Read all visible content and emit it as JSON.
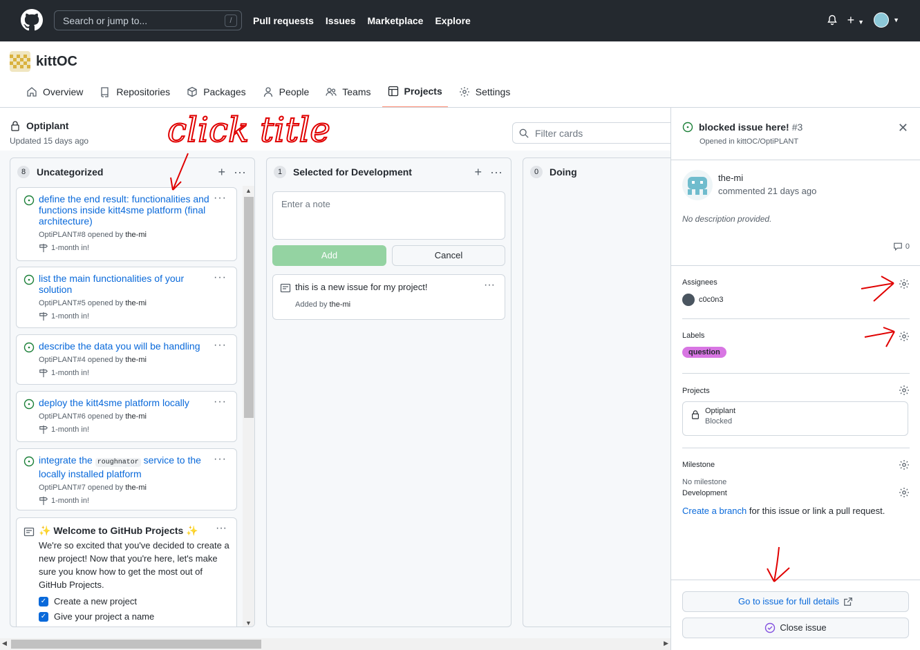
{
  "header": {
    "search_placeholder": "Search or jump to...",
    "search_shortcut": "/",
    "nav": [
      "Pull requests",
      "Issues",
      "Marketplace",
      "Explore"
    ]
  },
  "org": {
    "name": "kittOC",
    "tabs": [
      {
        "label": "Overview",
        "icon": "home-icon"
      },
      {
        "label": "Repositories",
        "icon": "repo-icon"
      },
      {
        "label": "Packages",
        "icon": "package-icon"
      },
      {
        "label": "People",
        "icon": "person-icon"
      },
      {
        "label": "Teams",
        "icon": "people-icon"
      },
      {
        "label": "Projects",
        "icon": "table-icon",
        "active": true
      },
      {
        "label": "Settings",
        "icon": "gear-icon"
      }
    ]
  },
  "project": {
    "title": "Optiplant",
    "updated": "Updated 15 days ago",
    "filter_placeholder": "Filter cards"
  },
  "columns": [
    {
      "name": "Uncategorized",
      "count": "8",
      "cards": [
        {
          "title": "define the end result: functionalities and functions inside kitt4sme platform (final architecture)",
          "ref": "OptiPLANT#8 opened by",
          "author": "the-mi",
          "milestone": "1-month in!"
        },
        {
          "title": "list the main functionalities of your solution",
          "ref": "OptiPLANT#5 opened by",
          "author": "the-mi",
          "milestone": "1-month in!"
        },
        {
          "title": "describe the data you will be handling",
          "ref": "OptiPLANT#4 opened by",
          "author": "the-mi",
          "milestone": "1-month in!"
        },
        {
          "title": "deploy the kitt4sme platform locally",
          "ref": "OptiPLANT#6 opened by",
          "author": "the-mi",
          "milestone": "1-month in!"
        },
        {
          "title_pre": "integrate the ",
          "title_code": "roughnator",
          "title_post": " service to the locally installed platform",
          "ref": "OptiPLANT#7 opened by",
          "author": "the-mi",
          "milestone": "1-month in!"
        }
      ],
      "welcome": {
        "title": "Welcome to GitHub Projects",
        "body": "We're so excited that you've decided to create a new project! Now that you're here, let's make sure you know how to get the most out of GitHub Projects.",
        "checks": [
          "Create a new project",
          "Give your project a name"
        ]
      }
    },
    {
      "name": "Selected for Development",
      "count": "1",
      "note_placeholder": "Enter a note",
      "add_label": "Add",
      "cancel_label": "Cancel",
      "note_card": {
        "text": "this is a new issue for my project!",
        "added_by": "Added by",
        "author": "the-mi"
      }
    },
    {
      "name": "Doing",
      "count": "0"
    }
  ],
  "panel": {
    "title": "blocked issue here!",
    "number": "#3",
    "opened_in": "Opened in kittOC/OptiPLANT",
    "commenter": "the-mi",
    "commented": "commented 21 days ago",
    "description": "No description provided.",
    "comment_count": "0",
    "assignees_heading": "Assignees",
    "assignee": "c0c0n3",
    "labels_heading": "Labels",
    "label": "question",
    "label_color": "#d876e3",
    "projects_heading": "Projects",
    "project_name": "Optiplant",
    "project_status": "Blocked",
    "milestone_heading": "Milestone",
    "milestone_value": "No milestone",
    "development_heading": "Development",
    "branch_link": "Create a branch",
    "branch_text": " for this issue or link a pull request.",
    "full_details": "Go to issue for full details",
    "close_issue": "Close issue"
  },
  "annotation": {
    "text": "click title",
    "color": "#e00000"
  }
}
